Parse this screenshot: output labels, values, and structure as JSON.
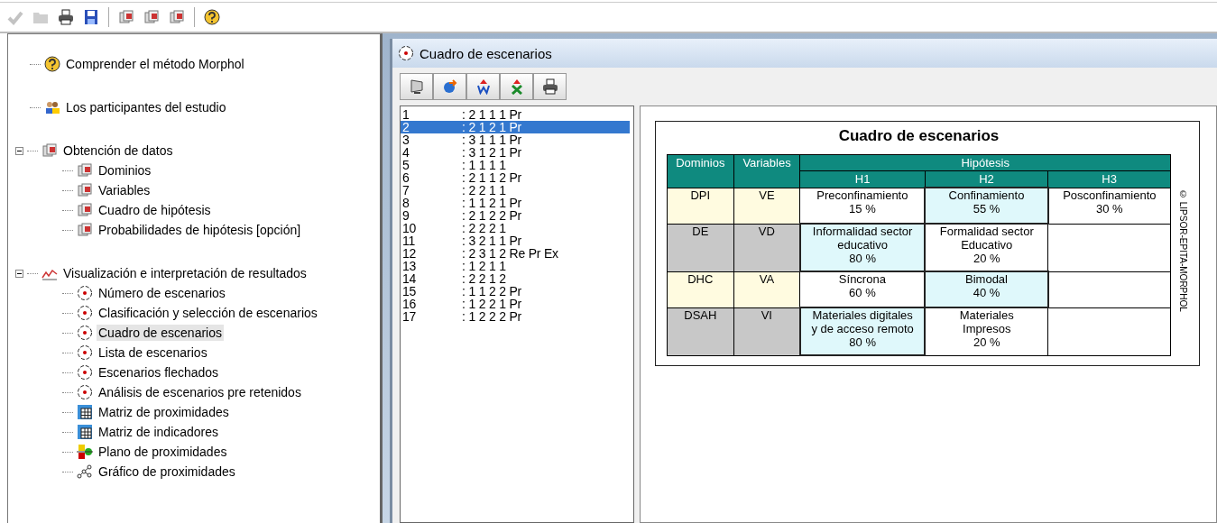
{
  "toolbar": [
    {
      "kind": "check",
      "disabled": true
    },
    {
      "kind": "folder",
      "disabled": true
    },
    {
      "kind": "print",
      "disabled": false
    },
    {
      "kind": "save",
      "disabled": false
    },
    {
      "kind": "separator"
    },
    {
      "kind": "data",
      "disabled": false
    },
    {
      "kind": "data",
      "disabled": false
    },
    {
      "kind": "data",
      "disabled": false
    },
    {
      "kind": "separator"
    },
    {
      "kind": "help",
      "disabled": false
    }
  ],
  "tree": [
    {
      "label": "Comprender el método Morphol",
      "kind": "help",
      "selected": false
    },
    {
      "label": "Los participantes del estudio",
      "kind": "people",
      "selected": false
    },
    {
      "label": "Obtención de datos",
      "kind": "data",
      "selected": false,
      "expanded": true,
      "children": [
        {
          "label": "Dominios",
          "kind": "data",
          "selected": false
        },
        {
          "label": "Variables",
          "kind": "data",
          "selected": false
        },
        {
          "label": "Cuadro de hipótesis",
          "kind": "data",
          "selected": false
        },
        {
          "label": "Probabilidades de hipótesis [opción]",
          "kind": "data",
          "selected": false
        }
      ]
    },
    {
      "label": "Visualización e interpretación de resultados",
      "kind": "chart",
      "selected": false,
      "expanded": true,
      "children": [
        {
          "label": "Número de escenarios",
          "kind": "target",
          "selected": false
        },
        {
          "label": "Clasificación y selección de escenarios",
          "kind": "target",
          "selected": false
        },
        {
          "label": "Cuadro de escenarios",
          "kind": "target",
          "selected": true
        },
        {
          "label": "Lista de escenarios",
          "kind": "target",
          "selected": false
        },
        {
          "label": "Escenarios flechados",
          "kind": "target",
          "selected": false
        },
        {
          "label": "Análisis de escenarios pre retenidos",
          "kind": "target",
          "selected": false
        },
        {
          "label": "Matriz de proximidades",
          "kind": "matrix",
          "selected": false
        },
        {
          "label": "Matriz de indicadores",
          "kind": "matrix",
          "selected": false
        },
        {
          "label": "Plano de proximidades",
          "kind": "plane",
          "selected": false
        },
        {
          "label": "Gráfico de proximidades",
          "kind": "graph",
          "selected": false
        }
      ]
    }
  ],
  "child_window": {
    "title": "Cuadro de escenarios",
    "tools": [
      {
        "kind": "monitor"
      },
      {
        "kind": "export"
      },
      {
        "kind": "word"
      },
      {
        "kind": "excel"
      },
      {
        "kind": "print"
      }
    ],
    "scenarios": [
      {
        "number": "1",
        "code": ": 2 1 1 1 Pr",
        "selected": false
      },
      {
        "number": "2",
        "code": ": 2 1 2 1 Pr",
        "selected": true
      },
      {
        "number": "3",
        "code": ": 3 1 1 1 Pr",
        "selected": false
      },
      {
        "number": "4",
        "code": ": 3 1 2 1 Pr",
        "selected": false
      },
      {
        "number": "5",
        "code": ": 1 1 1 1",
        "selected": false
      },
      {
        "number": "6",
        "code": ": 2 1 1 2 Pr",
        "selected": false
      },
      {
        "number": "7",
        "code": ": 2 2 1 1",
        "selected": false
      },
      {
        "number": "8",
        "code": ": 1 1 2 1 Pr",
        "selected": false
      },
      {
        "number": "9",
        "code": ": 2 1 2 2 Pr",
        "selected": false
      },
      {
        "number": "10",
        "code": ": 2 2 2 1",
        "selected": false
      },
      {
        "number": "11",
        "code": ": 3 2 1 1 Pr",
        "selected": false
      },
      {
        "number": "12",
        "code": ": 2 3 1 2 Re Pr Ex",
        "selected": false
      },
      {
        "number": "13",
        "code": ": 1 2 1 1",
        "selected": false
      },
      {
        "number": "14",
        "code": ": 2 2 1 2",
        "selected": false
      },
      {
        "number": "15",
        "code": ": 1 1 2 2 Pr",
        "selected": false
      },
      {
        "number": "16",
        "code": ": 1 2 2 1 Pr",
        "selected": false
      },
      {
        "number": "17",
        "code": ": 1 2 2 2 Pr",
        "selected": false
      }
    ],
    "table": {
      "title": "Cuadro de escenarios",
      "columns": [
        "Dominios",
        "Variables"
      ],
      "group_header": "Hipótesis",
      "hypothesis_columns": [
        "H1",
        "H2",
        "H3"
      ],
      "rows": [
        {
          "domain": "DPI",
          "variable": "VE",
          "color": "#fffbe0",
          "cells": [
            {
              "lines": [
                "Preconfinamiento",
                "15 %"
              ],
              "selected": false
            },
            {
              "lines": [
                "Confinamiento",
                "55 %"
              ],
              "selected": true
            },
            {
              "lines": [
                "Posconfinamiento",
                "30 %"
              ],
              "selected": false
            }
          ]
        },
        {
          "domain": "DE",
          "variable": "VD",
          "color": "#c8c8c8",
          "cells": [
            {
              "lines": [
                "Informalidad sector",
                "educativo",
                "80 %"
              ],
              "selected": true
            },
            {
              "lines": [
                "Formalidad sector",
                "Educativo",
                "20 %"
              ],
              "selected": false
            }
          ]
        },
        {
          "domain": "DHC",
          "variable": "VA",
          "color": "#fffbe0",
          "cells": [
            {
              "lines": [
                "Síncrona",
                "60 %"
              ],
              "selected": false
            },
            {
              "lines": [
                "Bimodal",
                "40 %"
              ],
              "selected": true
            }
          ]
        },
        {
          "domain": "DSAH",
          "variable": "VI",
          "color": "#c8c8c8",
          "cells": [
            {
              "lines": [
                "Materiales digitales",
                "y de acceso remoto",
                "80 %"
              ],
              "selected": true
            },
            {
              "lines": [
                "Materiales",
                "Impresos",
                "20 %"
              ],
              "selected": false
            }
          ]
        }
      ],
      "copyright": "© LIPSOR-EPITA-MORPHOL"
    }
  }
}
